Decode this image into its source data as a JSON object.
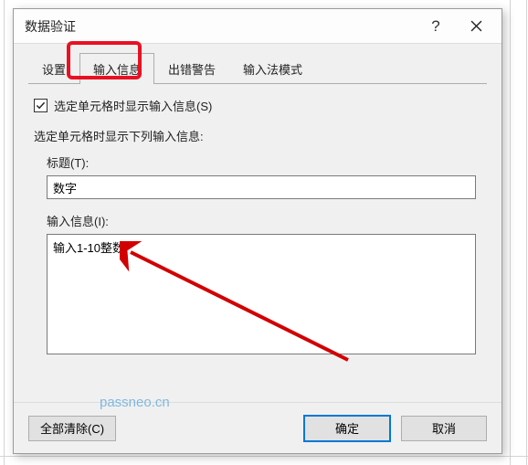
{
  "dialog": {
    "title": "数据验证",
    "help_symbol": "?",
    "tabs": [
      {
        "label": "设置",
        "active": false
      },
      {
        "label": "输入信息",
        "active": true
      },
      {
        "label": "出错警告",
        "active": false
      },
      {
        "label": "输入法模式",
        "active": false
      }
    ],
    "checkbox": {
      "checked": true,
      "label": "选定单元格时显示输入信息(S)"
    },
    "section_label": "选定单元格时显示下列输入信息:",
    "title_field": {
      "label": "标题(T):",
      "value": "数字"
    },
    "message_field": {
      "label": "输入信息(I):",
      "value": "输入1-10整数"
    },
    "buttons": {
      "clear_all": "全部清除(C)",
      "ok": "确定",
      "cancel": "取消"
    }
  },
  "annotation": {
    "box_color": "#e81123",
    "arrow_color": "#d20000",
    "watermark": "passneo.cn"
  }
}
